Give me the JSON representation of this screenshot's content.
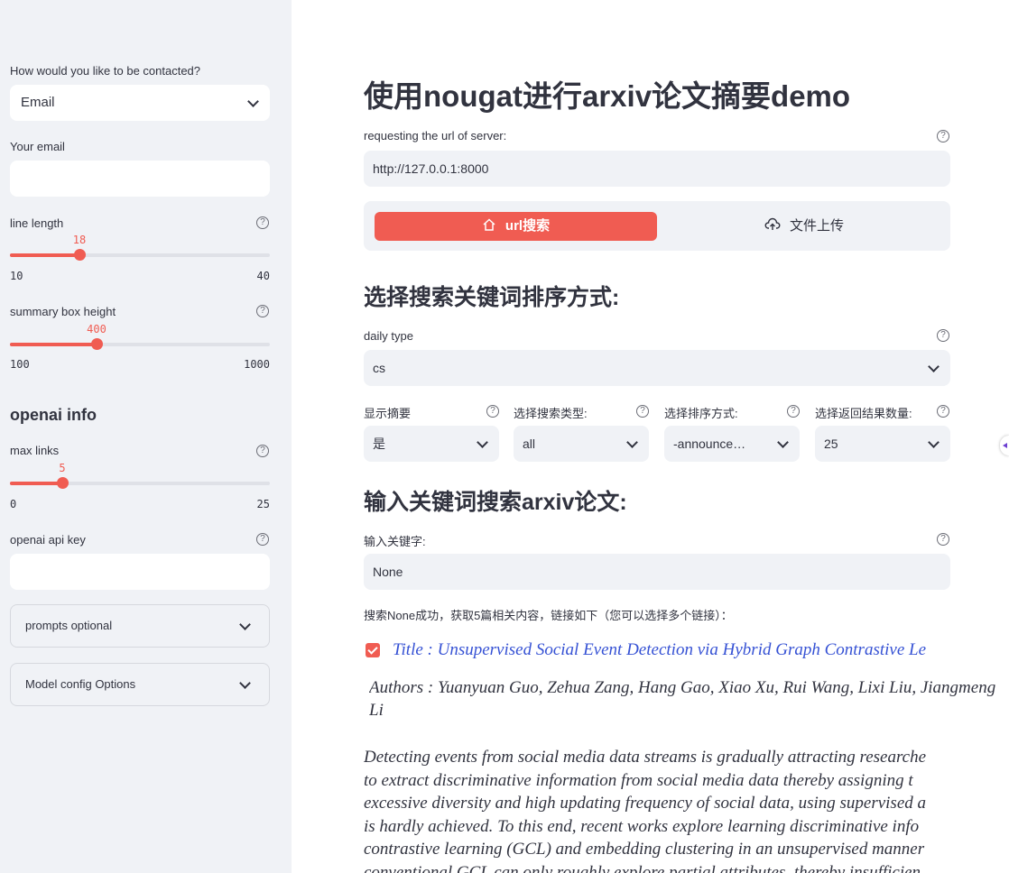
{
  "sidebar": {
    "contact_label": "How would you like to be contacted?",
    "contact_value": "Email",
    "email_label": "Your email",
    "email_value": "",
    "line_length": {
      "label": "line length",
      "value": "18",
      "min": "10",
      "max": "40",
      "fraction": 0.267
    },
    "summary_height": {
      "label": "summary box height",
      "value": "400",
      "min": "100",
      "max": "1000",
      "fraction": 0.333
    },
    "openai_heading": "openai info",
    "max_links": {
      "label": "max links",
      "value": "5",
      "min": "0",
      "max": "25",
      "fraction": 0.2
    },
    "api_key_label": "openai api key",
    "api_key_value": "",
    "expander_prompts": "prompts optional",
    "expander_model": "Model config Options"
  },
  "main": {
    "title": "使用nougat进行arxiv论文摘要demo",
    "url_label": "requesting the url of server:",
    "url_value": "http://127.0.0.1:8000",
    "tab_url": "url搜索",
    "tab_upload": "文件上传",
    "sort_heading": "选择搜索关键词排序方式:",
    "daily_type_label": "daily type",
    "daily_type_value": "cs",
    "show_summary_label": "显示摘要",
    "show_summary_value": "是",
    "search_type_label": "选择搜索类型:",
    "search_type_value": "all",
    "sort_label": "选择排序方式:",
    "sort_value": "-announce…",
    "result_count_label": "选择返回结果数量:",
    "result_count_value": "25",
    "keyword_heading": "输入关键词搜索arxiv论文:",
    "keyword_label": "输入关键字:",
    "keyword_value": "None",
    "result_msg": "搜索None成功，获取5篇相关内容，链接如下（您可以选择多个链接）：",
    "paper_title": "Title :  Unsupervised Social Event Detection via Hybrid Graph Contrastive  Le",
    "paper_authors": "Authors :  Yuanyuan Guo,  Zehua Zang,  Hang Gao,  Xiao Xu,  Rui Wang,  Lixi Liu,  Jiangmeng Li",
    "abstract_lines": [
      "Detecting events from social media data streams is gradually attracting researche",
      " to extract discriminative information from social media data thereby assigning t",
      " excessive diversity and high updating frequency of social data, using supervised a",
      " is hardly achieved. To this end, recent works explore learning discriminative info",
      " contrastive learning (GCL) and embedding clustering in an unsupervised manner",
      " conventional GCL can only roughly explore partial attributes, thereby insufficien"
    ]
  },
  "colors": {
    "accent": "#f05c52",
    "sidebar_bg": "#f0f2f6",
    "link": "#3551d4"
  }
}
